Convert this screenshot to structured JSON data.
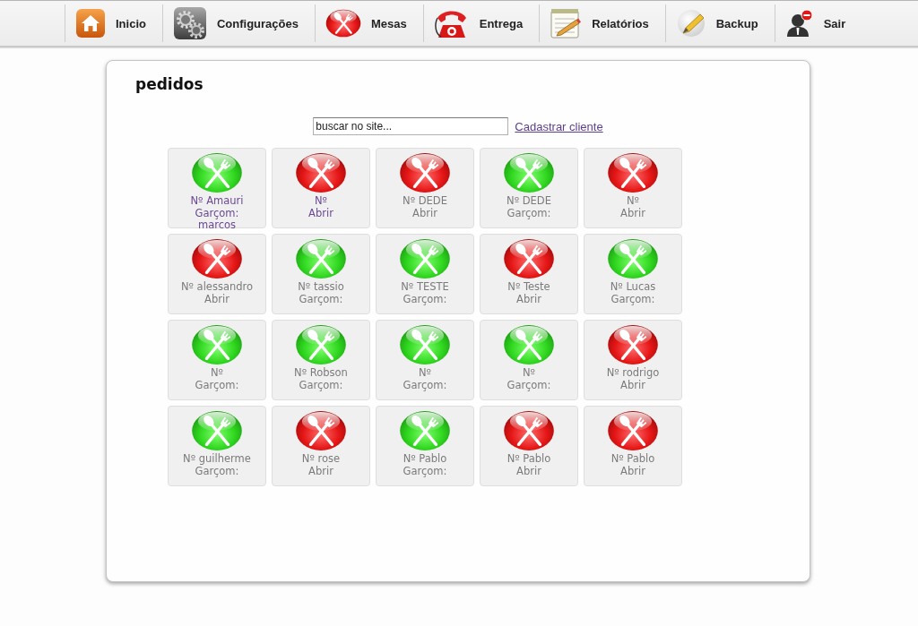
{
  "nav": {
    "items": [
      {
        "label": "Inicio",
        "kind": "home"
      },
      {
        "label": "Configurações",
        "kind": "settings"
      },
      {
        "label": "Mesas",
        "kind": "tables"
      },
      {
        "label": "Entrega",
        "kind": "delivery"
      },
      {
        "label": "Relatórios",
        "kind": "reports"
      },
      {
        "label": "Backup",
        "kind": "backup"
      },
      {
        "label": "Sair",
        "kind": "logout"
      }
    ]
  },
  "panel": {
    "title": "pedidos",
    "search": {
      "value": "buscar no site..."
    },
    "link": "Cadastrar cliente"
  },
  "tables": [
    {
      "occupied": true,
      "visited": true,
      "lines": [
        "Nº Amauri",
        "Garçom:",
        "marcos"
      ]
    },
    {
      "occupied": false,
      "visited": true,
      "lines": [
        "Nº",
        "Abrir"
      ]
    },
    {
      "occupied": false,
      "visited": false,
      "lines": [
        "Nº DEDE",
        "Abrir"
      ]
    },
    {
      "occupied": true,
      "visited": false,
      "lines": [
        "Nº DEDE",
        "Garçom:"
      ]
    },
    {
      "occupied": false,
      "visited": false,
      "lines": [
        "Nº",
        "Abrir"
      ]
    },
    {
      "occupied": false,
      "visited": false,
      "lines": [
        "Nº alessandro",
        "Abrir"
      ]
    },
    {
      "occupied": true,
      "visited": false,
      "lines": [
        "Nº tassio",
        "Garçom:"
      ]
    },
    {
      "occupied": true,
      "visited": false,
      "lines": [
        "Nº TESTE",
        "Garçom:"
      ]
    },
    {
      "occupied": false,
      "visited": false,
      "lines": [
        "Nº Teste",
        "Abrir"
      ]
    },
    {
      "occupied": true,
      "visited": false,
      "lines": [
        "Nº Lucas",
        "Garçom:"
      ]
    },
    {
      "occupied": true,
      "visited": false,
      "lines": [
        "Nº",
        "Garçom:"
      ]
    },
    {
      "occupied": true,
      "visited": false,
      "lines": [
        "Nº Robson",
        "Garçom:"
      ]
    },
    {
      "occupied": true,
      "visited": false,
      "lines": [
        "Nº",
        "Garçom:"
      ]
    },
    {
      "occupied": true,
      "visited": false,
      "lines": [
        "Nº",
        "Garçom:"
      ]
    },
    {
      "occupied": false,
      "visited": false,
      "lines": [
        "Nº rodrigo",
        "Abrir"
      ]
    },
    {
      "occupied": true,
      "visited": false,
      "lines": [
        "Nº guilherme",
        "Garçom:"
      ]
    },
    {
      "occupied": false,
      "visited": false,
      "lines": [
        "Nº rose",
        "Abrir"
      ]
    },
    {
      "occupied": true,
      "visited": false,
      "lines": [
        "Nº Pablo",
        "Garçom:"
      ]
    },
    {
      "occupied": false,
      "visited": false,
      "lines": [
        "Nº Pablo",
        "Abrir"
      ]
    },
    {
      "occupied": false,
      "visited": false,
      "lines": [
        "Nº Pablo",
        "Abrir"
      ]
    }
  ]
}
